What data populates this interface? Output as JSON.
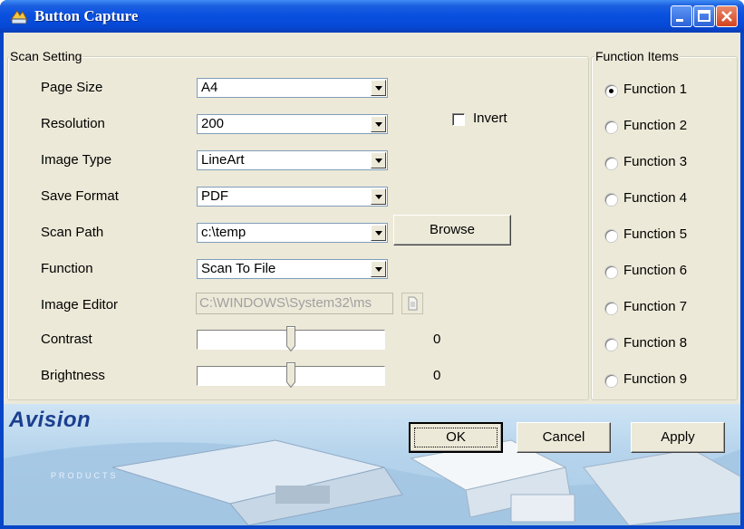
{
  "window": {
    "title": "Button Capture"
  },
  "scan_setting": {
    "legend": "Scan Setting",
    "page_size": {
      "label": "Page Size",
      "value": "A4"
    },
    "resolution": {
      "label": "Resolution",
      "value": "200"
    },
    "invert": {
      "label": "Invert",
      "checked": false
    },
    "image_type": {
      "label": "Image Type",
      "value": "LineArt"
    },
    "save_format": {
      "label": "Save Format",
      "value": "PDF"
    },
    "scan_path": {
      "label": "Scan Path",
      "value": "c:\\temp",
      "browse_label": "Browse"
    },
    "function": {
      "label": "Function",
      "value": "Scan To File"
    },
    "image_editor": {
      "label": "Image Editor",
      "value": "C:\\WINDOWS\\System32\\ms"
    },
    "contrast": {
      "label": "Contrast",
      "value": "0"
    },
    "brightness": {
      "label": "Brightness",
      "value": "0"
    }
  },
  "function_items": {
    "legend": "Function Items",
    "selected": "Function 1",
    "items": [
      "Function 1",
      "Function 2",
      "Function 3",
      "Function 4",
      "Function 5",
      "Function 6",
      "Function 7",
      "Function 8",
      "Function 9"
    ]
  },
  "banner": {
    "logo": "Avision",
    "tagline": "PRODUCTS"
  },
  "buttons": {
    "ok": "OK",
    "cancel": "Cancel",
    "apply": "Apply"
  },
  "colors": {
    "titlebar": "#0548d6",
    "dialog_bg": "#ece9d8",
    "close_button": "#d4431f",
    "logo": "#1b3f8f"
  }
}
